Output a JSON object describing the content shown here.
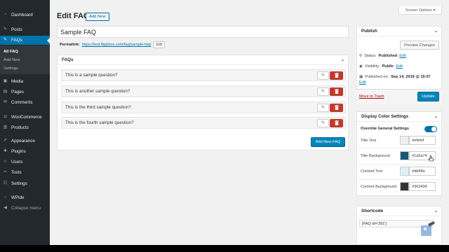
{
  "sidebar": {
    "items": [
      {
        "label": "Dashboard",
        "icon": "dashboard-icon",
        "glyph": "◔"
      },
      {
        "label": "Posts",
        "icon": "pushpin-icon",
        "glyph": "✎"
      },
      {
        "label": "FAQs",
        "icon": "faq-icon",
        "glyph": "✎"
      },
      {
        "label": "Media",
        "icon": "media-icon",
        "glyph": "▣"
      },
      {
        "label": "Pages",
        "icon": "pages-icon",
        "glyph": "▤"
      },
      {
        "label": "Comments",
        "icon": "comments-icon",
        "glyph": "✉"
      },
      {
        "label": "WooCommerce",
        "icon": "woocommerce-icon",
        "glyph": "◘"
      },
      {
        "label": "Products",
        "icon": "products-icon",
        "glyph": "▥"
      },
      {
        "label": "Appearance",
        "icon": "appearance-icon",
        "glyph": "✐"
      },
      {
        "label": "Plugins",
        "icon": "plugins-icon",
        "glyph": "✚"
      },
      {
        "label": "Users",
        "icon": "users-icon",
        "glyph": "☺"
      },
      {
        "label": "Tools",
        "icon": "tools-icon",
        "glyph": "✂"
      },
      {
        "label": "Settings",
        "icon": "settings-icon",
        "glyph": "☷"
      },
      {
        "label": "WPide",
        "icon": "wpide-icon",
        "glyph": "○"
      },
      {
        "label": "Collapse menu",
        "icon": "collapse-icon",
        "glyph": "◀"
      }
    ],
    "submenu": [
      "All FAQ",
      "Add New",
      "Settings"
    ]
  },
  "header": {
    "screen_options": "Screen Options ▾",
    "title": "Edit FAQ",
    "add_new": "Add New"
  },
  "post": {
    "title": "Sample FAQ",
    "permalink_label": "Permalink:",
    "permalink_url": "https://test.flippbox.com/faq/sample-faq/",
    "permalink_edit": "Edit"
  },
  "faqs": {
    "heading": "FAQs",
    "questions": [
      "This is a sample question?",
      "This is another sample question?",
      "This is the third sample question?",
      "This is the fourth sample question?"
    ],
    "edit_glyph": "✎",
    "add_new": "Add New FAQ"
  },
  "publish": {
    "heading": "Publish",
    "preview": "Preview Changes",
    "status_label": "Status:",
    "status_value": "Published",
    "visibility_label": "Visibility:",
    "visibility_value": "Public",
    "published_label": "Published on:",
    "published_value": "Sep 14, 2019 @ 15:07",
    "edit": "Edit",
    "trash": "Move to Trash",
    "update": "Update"
  },
  "display_colors": {
    "heading": "Display Color Settings",
    "override_label": "Override General Settings",
    "override_enabled": true,
    "rows": [
      {
        "label": "Title Text",
        "hex": "#efefef",
        "color": "#efefef"
      },
      {
        "label": "Title Background",
        "hex": "#1a5a74",
        "color": "#1a5a74"
      },
      {
        "label": "Content Text",
        "hex": "#dbf0fa",
        "color": "#dbf0fa"
      },
      {
        "label": "Content Background",
        "hex": "#363434",
        "color": "#363434"
      }
    ]
  },
  "shortcode": {
    "heading": "Shortcode",
    "value": "[FAQ id='391']"
  },
  "colors": {
    "accent": "#0073aa",
    "sidebar": "#23282d",
    "delete": "#c0392b"
  }
}
